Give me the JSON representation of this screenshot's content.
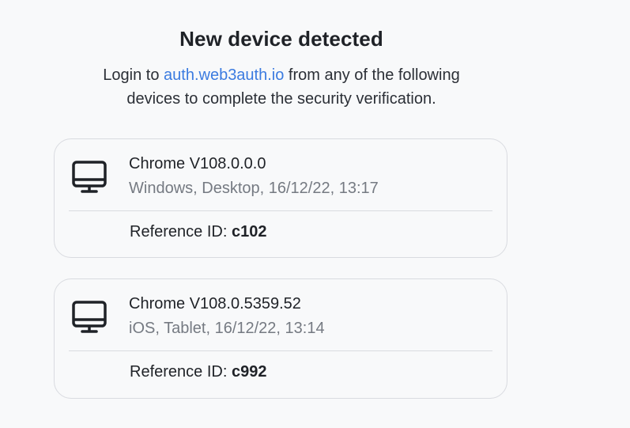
{
  "header": {
    "title": "New device detected",
    "subtitle_prefix": "Login to ",
    "link_text": "auth.web3auth.io",
    "subtitle_suffix_line1": " from any of the following",
    "subtitle_line2": "devices to complete the security verification."
  },
  "colors": {
    "link": "#3b7be0",
    "text_primary": "#1f2227",
    "text_secondary": "#757a82",
    "border": "#d9dbe0"
  },
  "devices": [
    {
      "icon": "desktop-monitor-icon",
      "name": "Chrome V108.0.0.0",
      "meta": "Windows, Desktop, 16/12/22, 13:17",
      "ref_label": "Reference ID: ",
      "ref_value": "c102"
    },
    {
      "icon": "desktop-monitor-icon",
      "name": "Chrome V108.0.5359.52",
      "meta": "iOS, Tablet, 16/12/22, 13:14",
      "ref_label": "Reference ID: ",
      "ref_value": "c992"
    }
  ]
}
